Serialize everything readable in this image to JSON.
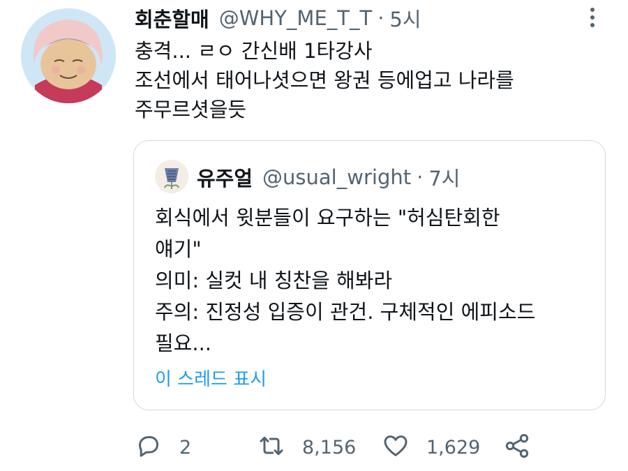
{
  "tweet": {
    "author_name": "회춘할매",
    "author_handle": "@WHY_ME_T_T",
    "separator": "·",
    "time": "5시",
    "lines": [
      "충격... ㄹㅇ 간신배 1타강사",
      "조선에서 태어나셧으면 왕권 등에업고 나라를",
      "주무르셧을듯"
    ]
  },
  "quoted": {
    "author_name": "유주얼",
    "author_handle": "@usual_wright",
    "separator": "·",
    "time": "7시",
    "lines": [
      "회식에서 윗분들이 요구하는 \"허심탄회한",
      "얘기\"",
      "의미: 실컷 내 칭찬을 해봐라",
      "주의: 진정성 입증이 관건. 구체적인 에피소드",
      "필요..."
    ],
    "thread_link": "이 스레드 표시"
  },
  "actions": {
    "reply_count": "2",
    "retweet_count": "8,156",
    "like_count": "1,629"
  },
  "colors": {
    "accent": "#1d9bf0",
    "secondary_text": "#536471",
    "border": "#cfd9de"
  },
  "icons": [
    "more-icon",
    "reply-icon",
    "retweet-icon",
    "like-icon",
    "share-icon"
  ]
}
